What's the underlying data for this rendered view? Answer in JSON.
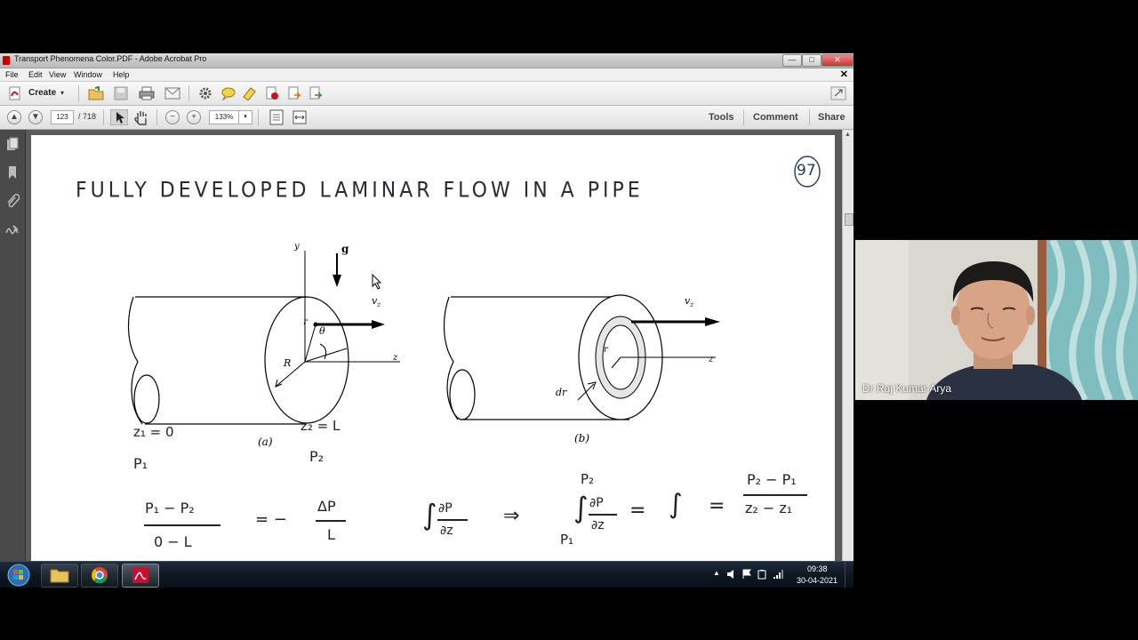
{
  "window": {
    "title": "Transport Phenomena Color.PDF - Adobe Acrobat Pro",
    "minimize": "—",
    "maximize": "□",
    "close": "✕"
  },
  "menu": [
    "File",
    "Edit",
    "View",
    "Window",
    "Help"
  ],
  "menu_close": "✕",
  "toolbar": {
    "create_label": "Create",
    "icons": [
      "open-icon",
      "save-icon",
      "print-icon",
      "email-icon",
      "settings-icon",
      "comment-icon",
      "highlight-icon",
      "delete-icon",
      "export-icon",
      "share-icon"
    ]
  },
  "nav": {
    "page_current": "123",
    "page_total": "/ 718",
    "zoom": "133%",
    "tools": "Tools",
    "comment": "Comment",
    "share": "Share"
  },
  "document": {
    "page_number": "97",
    "heading": "FULLY DEVELOPED LAMINAR FLOW IN A PIPE",
    "fig_a": {
      "caption": "(a)",
      "labels": {
        "y": "y",
        "g": "g",
        "vz": "v",
        "vz_sub": "z",
        "r": "r",
        "theta": "θ",
        "R": "R",
        "z": "z"
      },
      "z1": "z₁ = 0",
      "z2": "z₂ = L",
      "p1": "P₁",
      "p2": "P₂"
    },
    "fig_b": {
      "caption": "(b)",
      "labels": {
        "vz": "v",
        "vz_sub": "z",
        "r": "r",
        "dr": "dr",
        "z": "z"
      }
    },
    "eq": {
      "frac1_num": "P₁ − P₂",
      "frac1_den": "0 − L",
      "eq1_rhs": "= −",
      "dp_num": "ΔP",
      "dp_den": "L",
      "int_sym": "∫",
      "dpdz_num": "∂P",
      "dpdz_den": "∂z",
      "arrow": "⇒",
      "upper": "P₂",
      "lower": "P₁",
      "eq_sign": "=",
      "rhs_num": "P₂ − P₁",
      "rhs_den": "z₂ − z₁"
    }
  },
  "taskbar": {
    "time": "09:38",
    "date": "30-04-2021"
  },
  "webcam": {
    "participant": "Dr Raj Kumar Arya"
  },
  "colors": {
    "acrobat_red": "#c8102e",
    "taskbar": "#0e1822"
  }
}
